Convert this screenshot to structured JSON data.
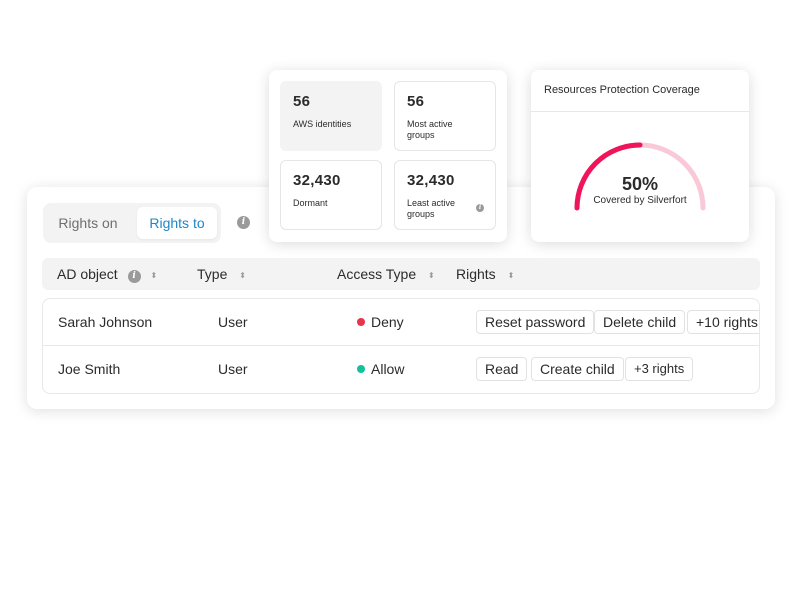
{
  "rights_panel": {
    "toggle": {
      "rights_on": "Rights on",
      "rights_to": "Rights to",
      "active": "rights_to"
    },
    "columns": {
      "ad_object": "AD object",
      "type": "Type",
      "access_type": "Access Type",
      "rights": "Rights"
    },
    "rows": [
      {
        "name": "Sarah Johnson",
        "type": "User",
        "access": "Deny",
        "access_color": "#e8334e",
        "rights": [
          "Reset password",
          "Delete child"
        ],
        "more": "+10 rights"
      },
      {
        "name": "Joe Smith",
        "type": "User",
        "access": "Allow",
        "access_color": "#13c29b",
        "rights": [
          "Read",
          "Create child"
        ],
        "more": "+3 rights"
      }
    ]
  },
  "stats": [
    {
      "value": "56",
      "label": "AWS identities"
    },
    {
      "value": "56",
      "label": "Most active groups"
    },
    {
      "value": "32,430",
      "label": "Dormant"
    },
    {
      "value": "32,430",
      "label": "Least active groups"
    }
  ],
  "coverage": {
    "title": "Resources Protection Coverage",
    "percent_label": "50%",
    "percent_value": 0.5,
    "subtitle": "Covered by Silverfort",
    "colors": {
      "covered": "#f0145a",
      "uncovered": "#f9c9d8"
    }
  },
  "colors": {
    "accent": "#1f86c9"
  }
}
